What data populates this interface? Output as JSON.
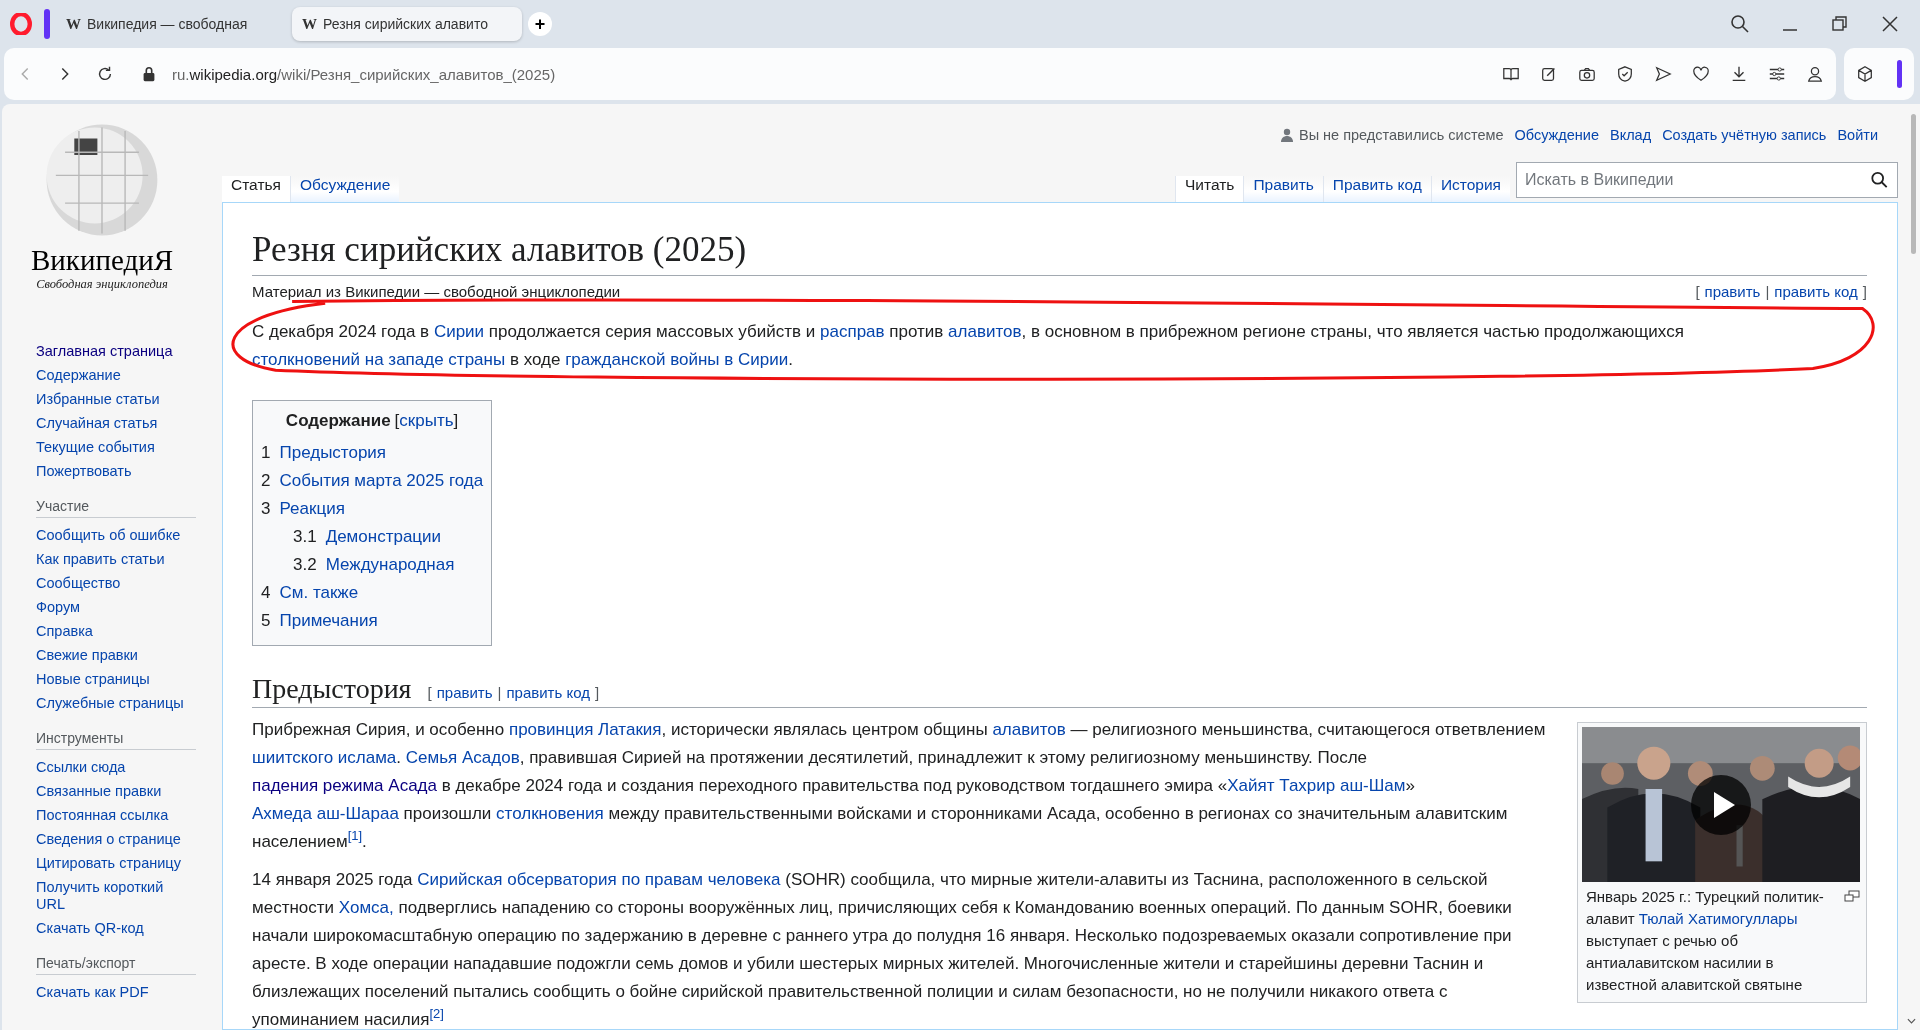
{
  "browser": {
    "tabs": [
      {
        "favicon": "W",
        "title": "Википедия — свободная",
        "selected": false
      },
      {
        "favicon": "W",
        "title": "Резня сирийских алавито",
        "selected": true
      }
    ],
    "new_tab": "+",
    "address": {
      "prefix": "ru.",
      "host": "wikipedia.org",
      "path": "/wiki/Резня_сирийских_алавитов_(2025)"
    }
  },
  "logo": {
    "wordmark": "ВикипедиЯ",
    "tagline": "Свободная энциклопедия"
  },
  "sidebar": [
    {
      "items": [
        {
          "label": "Заглавная страница",
          "visited": true
        },
        {
          "label": "Содержание",
          "visited": false
        },
        {
          "label": "Избранные статьи",
          "visited": false
        },
        {
          "label": "Случайная статья",
          "visited": false
        },
        {
          "label": "Текущие события",
          "visited": false
        },
        {
          "label": "Пожертвовать",
          "visited": false
        }
      ]
    },
    {
      "heading": "Участие",
      "items": [
        {
          "label": "Сообщить об ошибке",
          "visited": false
        },
        {
          "label": "Как править статьи",
          "visited": false
        },
        {
          "label": "Сообщество",
          "visited": false
        },
        {
          "label": "Форум",
          "visited": false
        },
        {
          "label": "Справка",
          "visited": false
        },
        {
          "label": "Свежие правки",
          "visited": false
        },
        {
          "label": "Новые страницы",
          "visited": false
        },
        {
          "label": "Служебные страницы",
          "visited": false
        }
      ]
    },
    {
      "heading": "Инструменты",
      "items": [
        {
          "label": "Ссылки сюда",
          "visited": false
        },
        {
          "label": "Связанные правки",
          "visited": false
        },
        {
          "label": "Постоянная ссылка",
          "visited": false
        },
        {
          "label": "Сведения о странице",
          "visited": false
        },
        {
          "label": "Цитировать страницу",
          "visited": false
        },
        {
          "label": "Получить короткий URL",
          "visited": false
        },
        {
          "label": "Скачать QR-код",
          "visited": false
        }
      ]
    },
    {
      "heading": "Печать/экспорт",
      "items": [
        {
          "label": "Скачать как PDF",
          "visited": false
        }
      ]
    }
  ],
  "personal": {
    "status": "Вы не представились системе",
    "links": [
      "Обсуждение",
      "Вклад",
      "Создать учётную запись",
      "Войти"
    ]
  },
  "tabs_left": [
    {
      "label": "Статья",
      "selected": true
    },
    {
      "label": "Обсуждение",
      "selected": false
    }
  ],
  "tabs_right": [
    {
      "label": "Читать",
      "selected": true
    },
    {
      "label": "Править",
      "selected": false
    },
    {
      "label": "Править код",
      "selected": false
    },
    {
      "label": "История",
      "selected": false
    }
  ],
  "search": {
    "placeholder": "Искать в Википедии"
  },
  "title": "Резня сирийских алавитов (2025)",
  "subtitle": "Материал из Википедии — свободной энциклопедии",
  "edit_links": {
    "open": "[",
    "links": [
      "править",
      "править код"
    ],
    "sep": "|",
    "close": "]"
  },
  "intro": {
    "circled": true,
    "segments": [
      {
        "kind": "text",
        "t": "С декабря 2024 года в "
      },
      {
        "kind": "link",
        "t": "Сирии"
      },
      {
        "kind": "text",
        "t": " продолжается серия массовых убийств и "
      },
      {
        "kind": "link",
        "t": "расправ"
      },
      {
        "kind": "text",
        "t": " против "
      },
      {
        "kind": "link",
        "t": "алавитов"
      },
      {
        "kind": "text",
        "t": ", в основном в прибрежном регионе страны, что является частью продолжающихся "
      },
      {
        "kind": "link",
        "t": "столкновений на западе страны"
      },
      {
        "kind": "text",
        "t": " в ходе "
      },
      {
        "kind": "link",
        "t": "гражданской войны в Сирии"
      },
      {
        "kind": "text",
        "t": "."
      }
    ]
  },
  "toc": {
    "title": "Содержание",
    "toggle": "скрыть",
    "open": "[",
    "close": "]",
    "items": [
      {
        "num": "1",
        "label": "Предыстория"
      },
      {
        "num": "2",
        "label": "События марта 2025 года"
      },
      {
        "num": "3",
        "label": "Реакция",
        "children": [
          {
            "num": "3.1",
            "label": "Демонстрации"
          },
          {
            "num": "3.2",
            "label": "Международная"
          }
        ]
      },
      {
        "num": "4",
        "label": "См. также"
      },
      {
        "num": "5",
        "label": "Примечания"
      }
    ]
  },
  "section": {
    "heading": "Предыстория",
    "edit_links": {
      "open": "[",
      "links": [
        "править",
        "править код"
      ],
      "sep": "|",
      "close": "]"
    }
  },
  "thumb": {
    "kind": "picture",
    "caption": [
      {
        "kind": "text",
        "t": "Январь 2025 г.: Турецкий политик-алавит "
      },
      {
        "kind": "link",
        "t": "Тюлай Хатимогуллары"
      },
      {
        "kind": "text",
        "t": " выступает с речью об антиалавитском насилии в известной алавитской святыне"
      }
    ]
  },
  "paragraphs": [
    [
      {
        "kind": "text",
        "t": "Прибрежная Сирия, и особенно "
      },
      {
        "kind": "link",
        "t": "провинция Латакия"
      },
      {
        "kind": "text",
        "t": ", исторически являлась центром общины "
      },
      {
        "kind": "link",
        "t": "алавитов"
      },
      {
        "kind": "text",
        "t": " — религиозного меньшинства, считающегося ответвлением "
      },
      {
        "kind": "link",
        "t": "шиитского ислама"
      },
      {
        "kind": "text",
        "t": ". "
      },
      {
        "kind": "link",
        "t": "Семья Асадов"
      },
      {
        "kind": "text",
        "t": ", правившая Сирией на протяжении десятилетий, принадлежит к этому религиозному меньшинству. После "
      },
      {
        "kind": "visited",
        "t": "падения режима Асада"
      },
      {
        "kind": "text",
        "t": " в декабре 2024 года и создания переходного правительства под руководством тогдашнего эмира «"
      },
      {
        "kind": "link",
        "t": "Хайят Тахрир аш-Шам"
      },
      {
        "kind": "text",
        "t": "» "
      },
      {
        "kind": "link",
        "t": "Ахмеда аш-Шараа"
      },
      {
        "kind": "text",
        "t": " произошли "
      },
      {
        "kind": "link",
        "t": "столкновения"
      },
      {
        "kind": "text",
        "t": " между правительственными войсками и сторонниками Асада, особенно в регионах со значительным алавитским населением"
      },
      {
        "kind": "ref",
        "t": "[1]"
      },
      {
        "kind": "text",
        "t": "."
      }
    ],
    [
      {
        "kind": "text",
        "t": "14 января 2025 года "
      },
      {
        "kind": "link",
        "t": "Сирийская обсерватория по правам человека"
      },
      {
        "kind": "text",
        "t": " (SOHR) сообщила, что мирные жители-алавиты из Таснина, расположенного в сельской местности "
      },
      {
        "kind": "link",
        "t": "Хомса,"
      },
      {
        "kind": "text",
        "t": " подверглись нападению со стороны вооружённых лиц, причисляющих себя к Командованию военных операций. По данным SOHR, боевики начали широкомасштабную операцию по задержанию в деревне с раннего утра до полудня 16 января. Несколько подозреваемых оказали сопротивление при аресте. В ходе операции нападавшие подожгли семь домов и убили шестерых мирных жителей. Многочисленные жители и старейшины деревни Таснин и близлежащих поселений пытались сообщить о бойне сирийской правительственной полиции и силам безопасности, но не получили никакого ответа с упоминанием насилия"
      },
      {
        "kind": "ref",
        "t": "[2]"
      }
    ]
  ]
}
